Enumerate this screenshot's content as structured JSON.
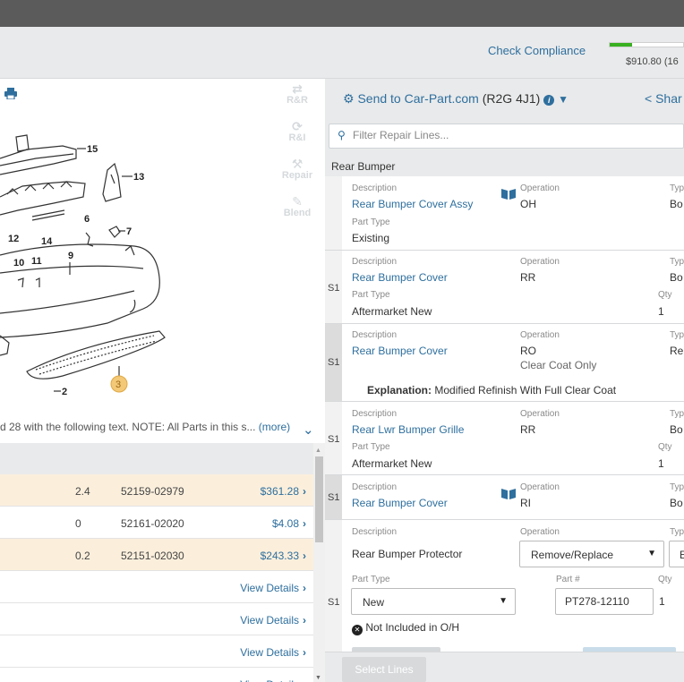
{
  "header": {
    "check_compliance": "Check Compliance",
    "progress_fraction": 0.3,
    "total_price": "$910.80 (16"
  },
  "left": {
    "tools": [
      {
        "name": "r-and-r-tool",
        "label": "R&R",
        "icon": "arrows-icon"
      },
      {
        "name": "r-and-i-tool",
        "label": "R&I",
        "icon": "refresh-icon"
      },
      {
        "name": "repair-tool",
        "label": "Repair",
        "icon": "hammer-icon"
      },
      {
        "name": "blend-tool",
        "label": "Blend",
        "icon": "spray-icon"
      }
    ],
    "diagram_callouts": [
      "15",
      "13",
      "12",
      "14",
      "6",
      "7",
      "10",
      "11",
      "9",
      "3",
      "2"
    ],
    "note_text": "d 28 with the following text. NOTE: All Parts in this s...",
    "note_more": "(more)",
    "parts": [
      {
        "qty": "2.4",
        "part_no": "52159-02979",
        "price": "$361.28",
        "highlight": true
      },
      {
        "qty": "0",
        "part_no": "52161-02020",
        "price": "$4.08",
        "highlight": false
      },
      {
        "qty": "0.2",
        "part_no": "52151-02030",
        "price": "$243.33",
        "highlight": true
      },
      {
        "qty": "",
        "part_no": "",
        "price": "View Details",
        "highlight": false
      },
      {
        "qty": "",
        "part_no": "",
        "price": "View Details",
        "highlight": false
      },
      {
        "qty": "",
        "part_no": "",
        "price": "View Details",
        "highlight": false
      },
      {
        "qty": "",
        "part_no": "",
        "price": "View Details",
        "highlight": false
      }
    ]
  },
  "right": {
    "send_label": "Send to Car-Part.com",
    "send_code": "(R2G 4J1)",
    "share_label": "Shar",
    "filter_placeholder": "Filter Repair Lines...",
    "section_title": "Rear Bumper",
    "labels": {
      "description": "Description",
      "operation": "Operation",
      "part_type": "Part Type",
      "type": "Typ",
      "qty": "Qty",
      "part_no": "Part #",
      "gutter": "S1"
    },
    "lines": [
      {
        "description": "Rear Bumper Cover Assy",
        "operation": "OH",
        "type": "Bo",
        "part_type": "Existing"
      },
      {
        "description": "Rear Bumper Cover",
        "operation": "RR",
        "type": "Bo",
        "part_type": "Aftermarket New",
        "qty": "1"
      },
      {
        "description": "Rear Bumper Cover",
        "operation": "RO",
        "operation_note": "Clear Coat Only",
        "type": "Re",
        "explanation_label": "Explanation:",
        "explanation": "Modified Refinish With Full Clear Coat"
      },
      {
        "description": "Rear Lwr Bumper Grille",
        "operation": "RR",
        "type": "Bo",
        "part_type": "Aftermarket New",
        "qty": "1"
      },
      {
        "description": "Rear Bumper Cover",
        "operation": "RI",
        "type": "Bo"
      }
    ],
    "edit_line": {
      "description": "Rear Bumper Protector",
      "operation": "Remove/Replace",
      "type_value": "E",
      "part_type": "New",
      "part_no": "PT278-12110",
      "qty": "1",
      "not_included": "Not Included in O/H"
    },
    "select_lines": "Select Lines"
  },
  "colors": {
    "link": "#2e6f9e",
    "progress": "#38b020",
    "highlight_row": "#fbefdc",
    "panel_bg": "#e9eaeb",
    "callout_badge": "#f3c877"
  }
}
